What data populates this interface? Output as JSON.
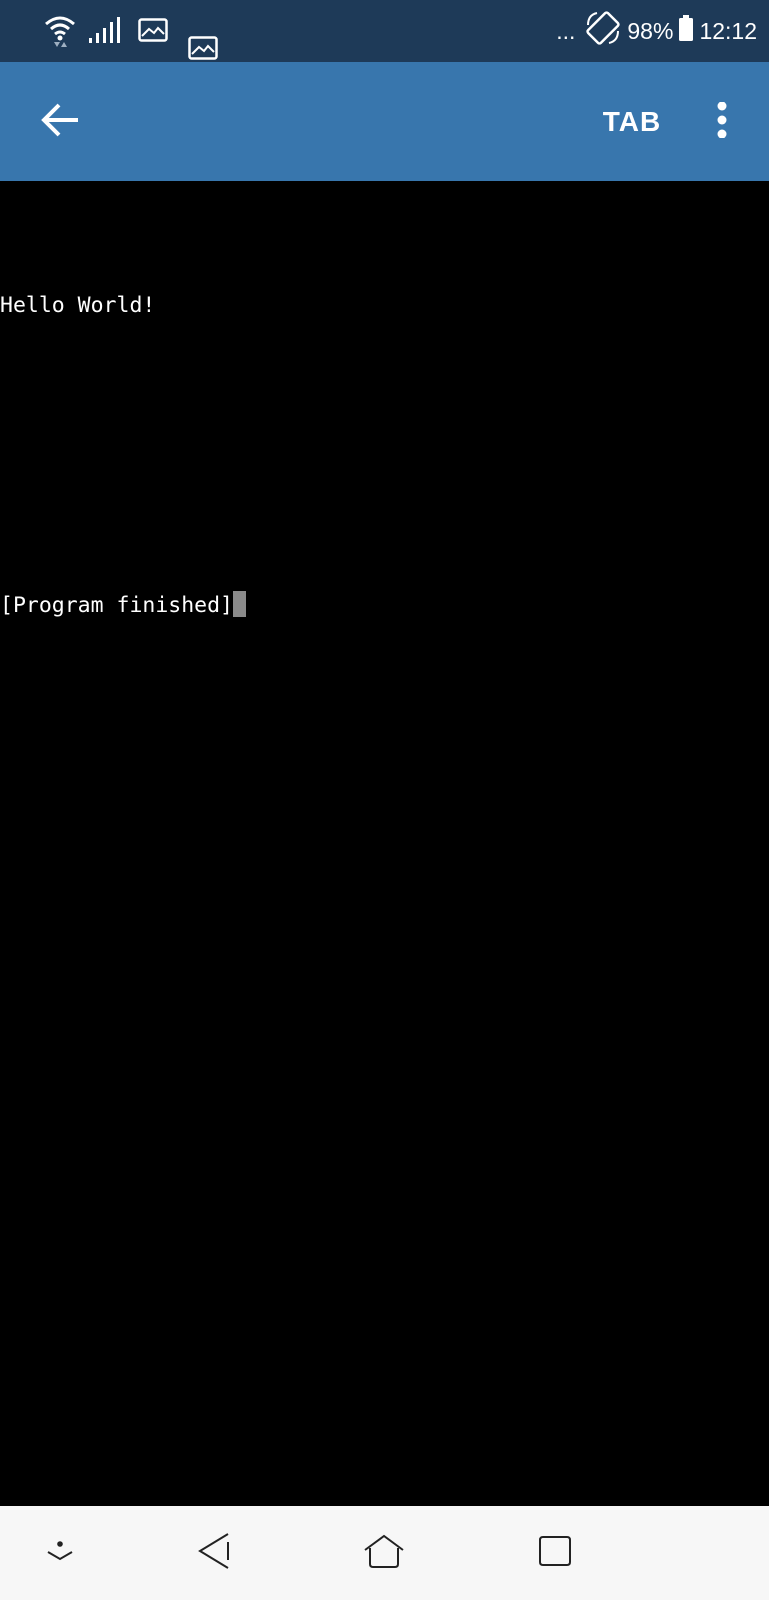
{
  "status_bar": {
    "overflow_dots": "...",
    "battery_percent": "98%",
    "time": "12:12",
    "icons": [
      "wifi-icon",
      "signal-icon",
      "image-notification-icon",
      "image-notification-icon",
      "auto-rotate-icon",
      "battery-icon"
    ]
  },
  "app_bar": {
    "back_icon": "arrow-left-icon",
    "tab_label": "TAB",
    "menu_icon": "more-vertical-icon"
  },
  "terminal": {
    "lines": [
      "Hello World!",
      "",
      "[Program finished]"
    ]
  },
  "nav_bar": {
    "icons": [
      "hide-keyboard-icon",
      "back-triangle-icon",
      "home-icon",
      "recents-icon"
    ]
  },
  "colors": {
    "status_bar_bg": "#1e3a58",
    "app_bar_bg": "#3876ad",
    "terminal_bg": "#000000",
    "terminal_fg": "#ffffff",
    "cursor": "#8a8a8a",
    "nav_bar_bg": "#f7f7f7"
  }
}
